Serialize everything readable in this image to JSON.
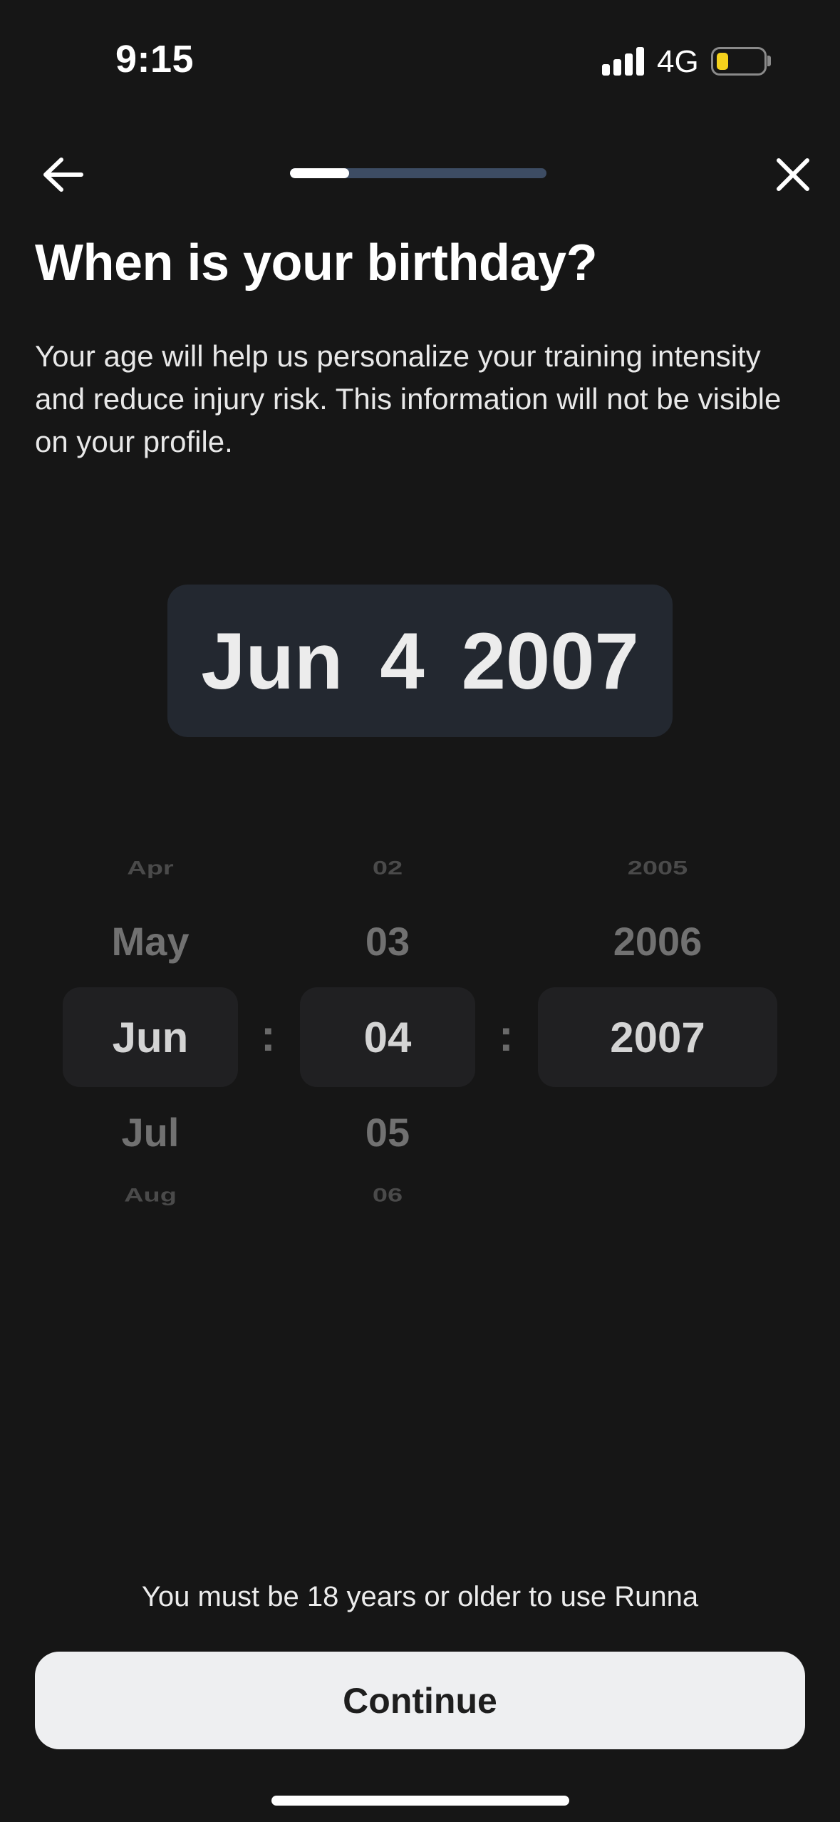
{
  "status_bar": {
    "time": "9:15",
    "network": "4G",
    "battery_level": 0.2,
    "battery_color": "#f5d21c",
    "signal_icon": "signal-bars-icon",
    "battery_icon": "battery-icon"
  },
  "nav": {
    "back_icon": "arrow-left-icon",
    "close_icon": "close-icon",
    "progress": 0.23
  },
  "title": "When is your birthday?",
  "description": "Your age will help us personalize your training intensity and reduce injury risk. This information will not be visible on your profile.",
  "date_display": {
    "month": "Jun",
    "day": "4",
    "year": "2007"
  },
  "picker": {
    "separator": ":",
    "month": {
      "above_far": "Apr",
      "above_near": "May",
      "selected": "Jun",
      "below_near": "Jul",
      "below_far": "Aug"
    },
    "day": {
      "above_far": "02",
      "above_near": "03",
      "selected": "04",
      "below_near": "05",
      "below_far": "06"
    },
    "year": {
      "above_far": "2005",
      "above_near": "2006",
      "selected": "2007"
    }
  },
  "footer": {
    "age_notice": "You must be 18 years or older to use Runna",
    "continue_label": "Continue"
  },
  "colors": {
    "background": "#161616",
    "progress_track": "#3d4c63",
    "date_display_bg": "#232830",
    "button_bg": "#eeeff1"
  }
}
